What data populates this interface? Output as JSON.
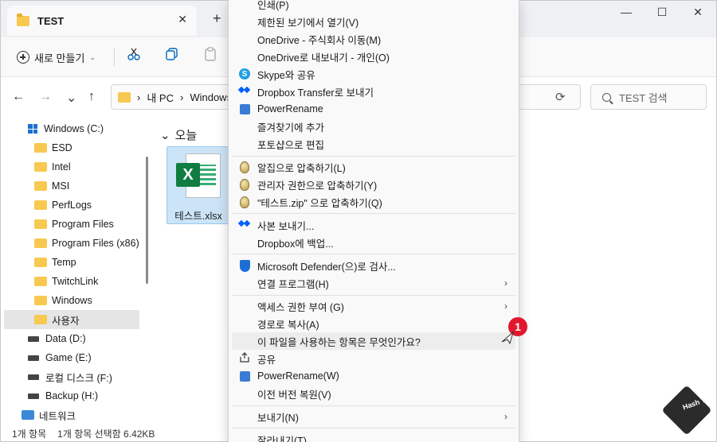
{
  "window": {
    "tab_title": "TEST",
    "tab_close": "✕",
    "new_tab": "+",
    "minimize": "—",
    "maximize": "☐",
    "close": "✕"
  },
  "toolbar": {
    "new_label": "새로 만들기",
    "new_chevron": "⌄"
  },
  "nav": {
    "back": "←",
    "forward": "→",
    "recent": "⌄",
    "up": "↑",
    "breadcrumb": [
      "›",
      "내 PC",
      "›",
      "Windows"
    ],
    "refresh": "⟳",
    "search_placeholder": "TEST 검색"
  },
  "sidebar": {
    "items": [
      {
        "label": "Windows (C:)",
        "kind": "winlogo"
      },
      {
        "label": "ESD",
        "kind": "folder"
      },
      {
        "label": "Intel",
        "kind": "folder"
      },
      {
        "label": "MSI",
        "kind": "folder"
      },
      {
        "label": "PerfLogs",
        "kind": "folder"
      },
      {
        "label": "Program Files",
        "kind": "folder"
      },
      {
        "label": "Program Files (x86)",
        "kind": "folder"
      },
      {
        "label": "Temp",
        "kind": "folder"
      },
      {
        "label": "TwitchLink",
        "kind": "folder"
      },
      {
        "label": "Windows",
        "kind": "folder"
      },
      {
        "label": "사용자",
        "kind": "folder"
      },
      {
        "label": "Data (D:)",
        "kind": "drive"
      },
      {
        "label": "Game (E:)",
        "kind": "drive"
      },
      {
        "label": "로컬 디스크 (F:)",
        "kind": "drive"
      },
      {
        "label": "Backup (H:)",
        "kind": "drive"
      },
      {
        "label": "네트워크",
        "kind": "network"
      }
    ]
  },
  "main": {
    "group_chevron": "⌄",
    "group_label": "오늘",
    "file_name": "테스트.xlsx",
    "xl_letter": "X"
  },
  "status": {
    "count": "1개 항목",
    "selection": "1개 항목 선택함 6.42KB"
  },
  "context_menu": {
    "items": [
      {
        "label": "인쇄(P)",
        "icon": ""
      },
      {
        "label": "제한된 보기에서 열기(V)",
        "icon": ""
      },
      {
        "label": "OneDrive - 주식회사 이동(M)",
        "icon": ""
      },
      {
        "label": "OneDrive로 내보내기 - 개인(O)",
        "icon": ""
      },
      {
        "label": "Skype와 공유",
        "icon": "skype-icon"
      },
      {
        "label": "Dropbox Transfer로 보내기",
        "icon": "dropbox-icon"
      },
      {
        "label": "PowerRename",
        "icon": "powerrename-icon"
      },
      {
        "label": "즐겨찾기에 추가",
        "icon": ""
      },
      {
        "label": "포토샵으로 편집",
        "icon": ""
      },
      {
        "label": "알집으로 압축하기(L)",
        "icon": "alzip-icon"
      },
      {
        "label": "관리자 권한으로 압축하기(Y)",
        "icon": "alzip-admin-icon"
      },
      {
        "label": "\"테스트.zip\" 으로 압축하기(Q)",
        "icon": "alzip-icon"
      },
      {
        "label": "사본 보내기...",
        "icon": "dropbox-icon"
      },
      {
        "label": "Dropbox에 백업...",
        "icon": ""
      },
      {
        "label": "Microsoft Defender(으)로 검사...",
        "icon": "defender-icon"
      },
      {
        "label": "연결 프로그램(H)",
        "icon": "",
        "submenu": true
      },
      {
        "label": "액세스 권한 부여 (G)",
        "icon": "",
        "submenu": true
      },
      {
        "label": "경로로 복사(A)",
        "icon": ""
      },
      {
        "label": "이 파일을 사용하는 항목은 무엇인가요?",
        "icon": "",
        "highlight": true
      },
      {
        "label": "공유",
        "icon": "share-icon"
      },
      {
        "label": "PowerRename(W)",
        "icon": "powerrename-icon"
      },
      {
        "label": "이전 버전 복원(V)",
        "icon": ""
      },
      {
        "label": "보내기(N)",
        "icon": "",
        "submenu": true
      },
      {
        "label": "잘라내기(T)",
        "icon": ""
      }
    ],
    "submenu_arrow": "›",
    "badge": "1"
  },
  "watermark": {
    "text": "Hash Tag"
  }
}
